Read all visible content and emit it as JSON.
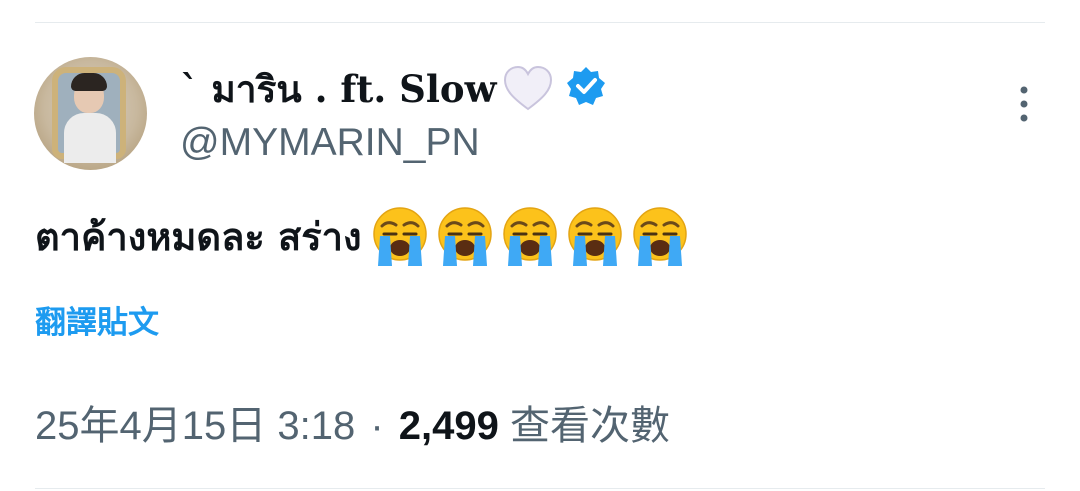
{
  "tweet": {
    "author": {
      "display_name": "` มาริน . ft. Slow",
      "name_emoji": "white-heart",
      "handle": "@MYMARIN_PN",
      "verified": true
    },
    "text": "ตาค้างหมดละ สร่าง",
    "emoji": [
      "loudly-crying-face",
      "loudly-crying-face",
      "loudly-crying-face",
      "loudly-crying-face",
      "loudly-crying-face"
    ],
    "translate_label": "翻譯貼文",
    "meta": {
      "timestamp": "25年4月15日 3:18",
      "separator": "·",
      "views_count": "2,499",
      "views_label": "查看次數"
    }
  },
  "colors": {
    "link": "#1d9bf0",
    "secondary_text": "#536471",
    "primary_text": "#0f1419",
    "verified_badge": "#1d9bf0"
  }
}
